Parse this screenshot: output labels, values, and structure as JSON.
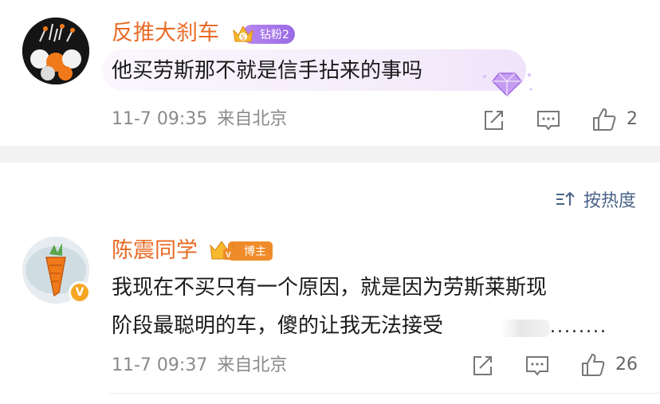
{
  "sort": {
    "label": "按热度",
    "icon": "sort-icon"
  },
  "comments": [
    {
      "username": "反推大刹车",
      "badge": {
        "level": "5",
        "text": "钻粉2",
        "icon": "crown-icon"
      },
      "text": "他买劳斯那不就是信手拈来的事吗",
      "time": "11-7 09:35",
      "location": "来自北京",
      "likes": "2",
      "decoration": "diamond-icon"
    },
    {
      "username": "陈震同学",
      "badge": {
        "level": "V",
        "text": "博主",
        "icon": "crown-icon"
      },
      "text_line1": "我现在不买只有一个原因，就是因为劳斯莱斯现",
      "text_line2": "阶段最聪明的车，傻的让我无法接受",
      "text_tail": "........",
      "time": "11-7 09:37",
      "location": "来自北京",
      "likes": "26",
      "verified": "V"
    }
  ],
  "colors": {
    "username": "#e86b26",
    "meta": "#8a8a8a",
    "sort": "#4a6387"
  }
}
